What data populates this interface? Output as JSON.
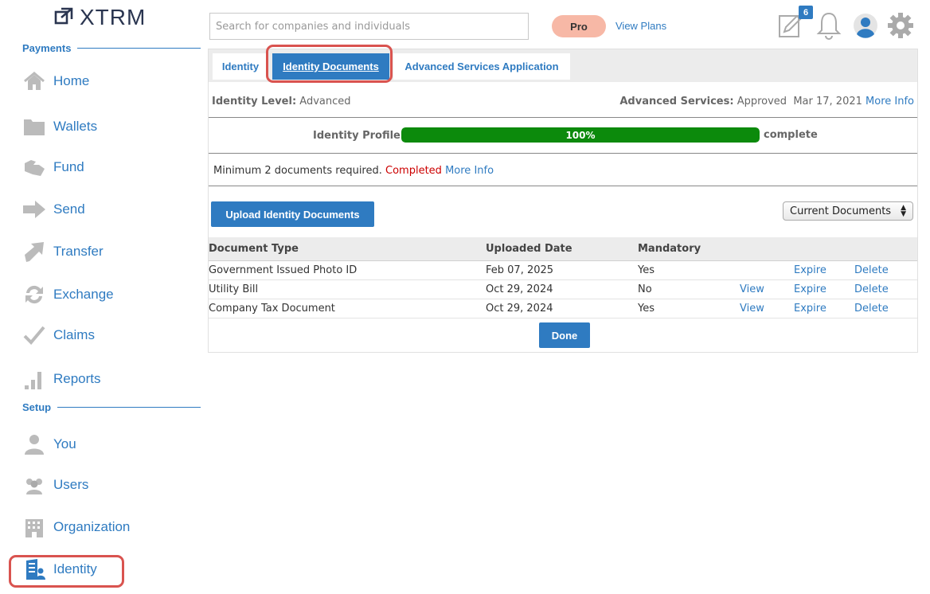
{
  "brand": {
    "logo_text": "XTRM"
  },
  "sidebar": {
    "sections": [
      {
        "title": "Payments"
      },
      {
        "title": "Setup"
      }
    ],
    "items": [
      {
        "label": "Home",
        "icon": "home-icon"
      },
      {
        "label": "Wallets",
        "icon": "folder-icon"
      },
      {
        "label": "Fund",
        "icon": "hand-icon"
      },
      {
        "label": "Send",
        "icon": "arrow-right-icon"
      },
      {
        "label": "Transfer",
        "icon": "arrow-diagonal-icon"
      },
      {
        "label": "Exchange",
        "icon": "exchange-icon"
      },
      {
        "label": "Claims",
        "icon": "checkmark-icon"
      },
      {
        "label": "Reports",
        "icon": "bar-chart-icon"
      },
      {
        "label": "You",
        "icon": "person-icon"
      },
      {
        "label": "Users",
        "icon": "users-icon"
      },
      {
        "label": "Organization",
        "icon": "building-icon"
      },
      {
        "label": "Identity",
        "icon": "identity-icon"
      }
    ]
  },
  "header": {
    "search_placeholder": "Search for companies and individuals",
    "pro_label": "Pro",
    "view_plans": "View Plans",
    "notifications_count": "6",
    "icons": [
      "edit-icon",
      "bell-icon",
      "user-avatar-icon",
      "gear-icon"
    ]
  },
  "tabs": [
    {
      "label": "Identity",
      "active": false
    },
    {
      "label": "Identity Documents",
      "active": true
    },
    {
      "label": "Advanced Services Application",
      "active": false
    }
  ],
  "identity": {
    "level_label": "Identity Level:",
    "level_value": "Advanced",
    "services_label": "Advanced Services:",
    "services_value": "Approved",
    "services_date": "Mar 17, 2021",
    "more_info": "More Info",
    "profile_label": "Identity Profile",
    "profile_percent": "100%",
    "profile_progress": 1.0,
    "complete_label": "complete",
    "min_docs_text": "Minimum 2 documents required.",
    "min_docs_status": "Completed",
    "min_docs_more": "More Info"
  },
  "actions": {
    "upload_label": "Upload Identity Documents",
    "filter_selected": "Current Documents",
    "done_label": "Done"
  },
  "table": {
    "headers": [
      "Document Type",
      "Uploaded Date",
      "Mandatory"
    ],
    "rows": [
      {
        "type": "Government Issued Photo ID",
        "date": "Feb 07, 2025",
        "mandatory": "Yes",
        "view": "",
        "expire": "Expire",
        "delete": "Delete"
      },
      {
        "type": "Utility Bill",
        "date": "Oct 29, 2024",
        "mandatory": "No",
        "view": "View",
        "expire": "Expire",
        "delete": "Delete"
      },
      {
        "type": "Company Tax Document",
        "date": "Oct 29, 2024",
        "mandatory": "Yes",
        "view": "View",
        "expire": "Expire",
        "delete": "Delete"
      }
    ]
  },
  "colors": {
    "accent": "#2f7bc1",
    "highlight": "#d9534f",
    "progress": "#0c8a0c",
    "status_completed": "#cc0000"
  }
}
